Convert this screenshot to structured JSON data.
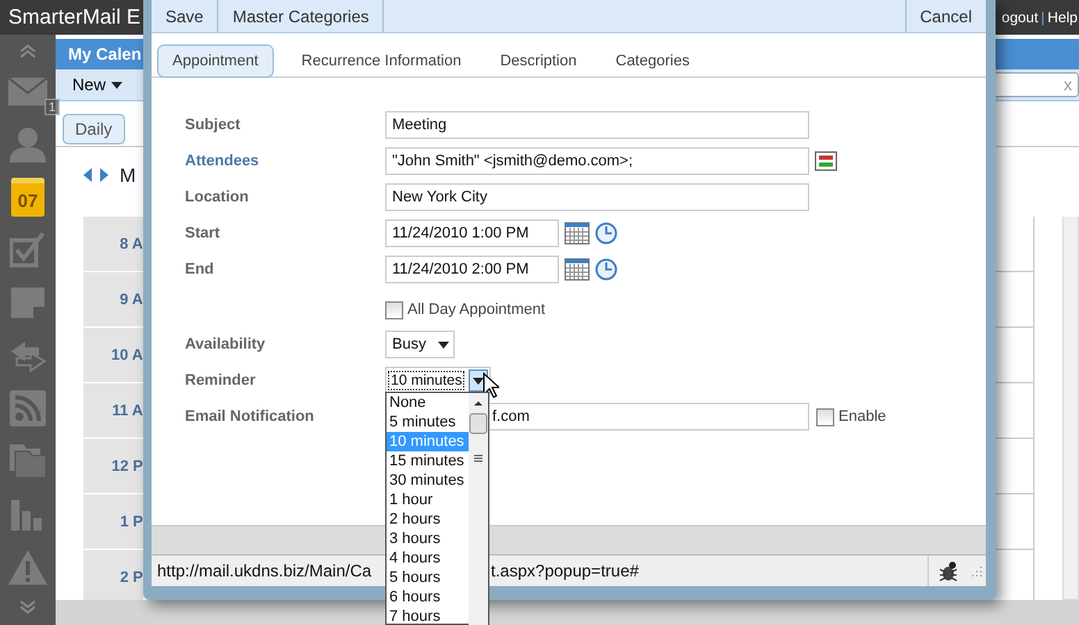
{
  "app": {
    "title": "SmarterMail E",
    "top_links": [
      {
        "label": "ogout"
      },
      {
        "label": "Help"
      }
    ],
    "link_separator": "|"
  },
  "sidebar": {
    "items": [
      {
        "kind": "collapse"
      },
      {
        "kind": "mail",
        "badge": "1",
        "selected": false
      },
      {
        "kind": "contacts",
        "selected": false
      },
      {
        "kind": "calendar",
        "date": "07",
        "selected": true
      },
      {
        "kind": "tasks",
        "selected": false
      },
      {
        "kind": "notes",
        "selected": false
      },
      {
        "kind": "sync",
        "selected": false
      },
      {
        "kind": "feeds",
        "selected": false
      },
      {
        "kind": "files",
        "selected": false
      },
      {
        "kind": "reports",
        "selected": false
      },
      {
        "kind": "alerts",
        "selected": false
      },
      {
        "kind": "expand"
      }
    ]
  },
  "calendar": {
    "title": "My Calen",
    "new_button": "New",
    "search": {
      "clear": "x"
    },
    "views": [
      {
        "label": "Daily",
        "selected": true
      }
    ],
    "heading": "M",
    "time_slots": [
      "8 A",
      "9 A",
      "10 A",
      "11 A",
      "12 P",
      "1 P",
      "2 P"
    ]
  },
  "dialog": {
    "toolbar": {
      "left": [
        "Save",
        "Master Categories"
      ],
      "right": [
        "Cancel"
      ]
    },
    "tabs": [
      {
        "label": "Appointment",
        "selected": true
      },
      {
        "label": "Recurrence Information",
        "selected": false
      },
      {
        "label": "Description",
        "selected": false
      },
      {
        "label": "Categories",
        "selected": false
      }
    ],
    "rows": [
      {
        "kind": "text",
        "label": "Subject",
        "value": "Meeting"
      },
      {
        "kind": "text",
        "label": "Attendees",
        "link": true,
        "address_book": true,
        "value": "\"John Smith\" <jsmith@demo.com>;"
      },
      {
        "kind": "text",
        "label": "Location",
        "value": "New York City"
      },
      {
        "kind": "datetime",
        "label": "Start",
        "value": "11/24/2010 1:00 PM"
      },
      {
        "kind": "datetime",
        "label": "End",
        "value": "11/24/2010 2:00 PM"
      },
      {
        "kind": "checkbox",
        "text": "All Day Appointment",
        "checked": false
      },
      {
        "kind": "select",
        "label": "Availability",
        "value": "Busy",
        "open": false
      },
      {
        "kind": "select",
        "label": "Reminder",
        "value": "10 minutes",
        "open": true,
        "options": [
          {
            "label": "None",
            "selected": false
          },
          {
            "label": "5 minutes",
            "selected": false
          },
          {
            "label": "10 minutes",
            "selected": true
          },
          {
            "label": "15 minutes",
            "selected": false
          },
          {
            "label": "30 minutes",
            "selected": false
          },
          {
            "label": "1 hour",
            "selected": false
          },
          {
            "label": "2 hours",
            "selected": false
          },
          {
            "label": "3 hours",
            "selected": false
          },
          {
            "label": "4 hours",
            "selected": false
          },
          {
            "label": "5 hours",
            "selected": false
          },
          {
            "label": "6 hours",
            "selected": false
          },
          {
            "label": "7 hours",
            "selected": false
          }
        ]
      },
      {
        "kind": "email",
        "label": "Email Notification",
        "value": "f.com",
        "enable_label": "Enable",
        "checked": false
      }
    ],
    "status_bar": {
      "url_parts": [
        "http://mail.ukdns.biz/Main/Ca",
        "t.aspx?popup=true#"
      ]
    }
  }
}
